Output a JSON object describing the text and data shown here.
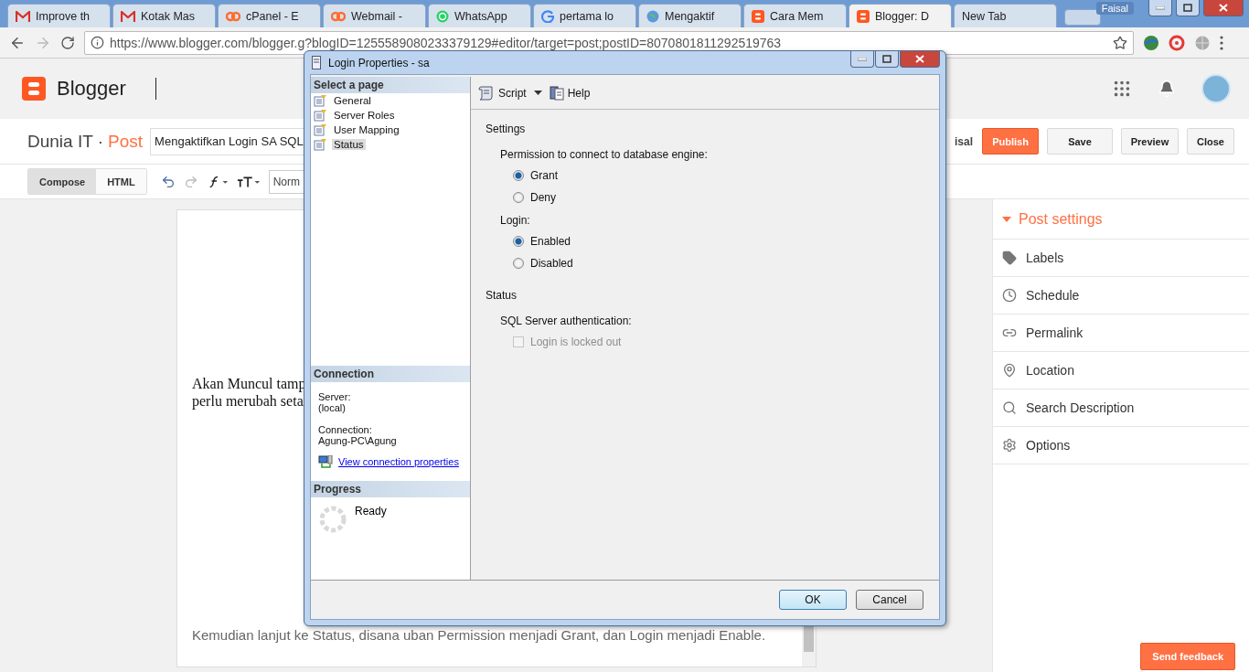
{
  "browser": {
    "tabs": [
      {
        "label": "Improve th",
        "kind": "gmail",
        "selected": false
      },
      {
        "label": "Kotak Mas",
        "kind": "gmail",
        "selected": false
      },
      {
        "label": "cPanel - E",
        "kind": "cpanel",
        "selected": false
      },
      {
        "label": "Webmail -",
        "kind": "cpanel",
        "selected": false
      },
      {
        "label": "WhatsApp",
        "kind": "whatsapp",
        "selected": false
      },
      {
        "label": "pertama lo",
        "kind": "google",
        "selected": false
      },
      {
        "label": "Mengaktif",
        "kind": "globe",
        "selected": false
      },
      {
        "label": "Cara Mem",
        "kind": "blogger",
        "selected": false
      },
      {
        "label": "Blogger: D",
        "kind": "blogger",
        "selected": true
      },
      {
        "label": "New Tab",
        "kind": "plain",
        "selected": false
      }
    ],
    "user": "Faisal",
    "url": "https://www.blogger.com/blogger.g?blogID=1255589080233379129#editor/target=post;postID=8070801811292519763"
  },
  "blogger": {
    "brand": "Blogger",
    "blog_name": "Dunia IT ·",
    "section": "Post",
    "post_title": "Mengaktifkan Login SA SQL",
    "author": "isal",
    "actions": [
      {
        "label": "Publish",
        "kind": "primary"
      },
      {
        "label": "Save",
        "kind": "default"
      },
      {
        "label": "Preview",
        "kind": "default"
      },
      {
        "label": "Close",
        "kind": "default"
      }
    ],
    "modes": [
      {
        "label": "Compose",
        "selected": true
      },
      {
        "label": "HTML",
        "selected": false
      }
    ],
    "format": "Norm",
    "editor_lines": [
      "Akan Muncul tamp",
      "perlu merubah seta"
    ],
    "editor_bottom": "Kemudian lanjut ke Status, disana uban Permission menjadi Grant, dan Login menjadi Enable.",
    "settings": {
      "title": "Post settings",
      "expanded": true,
      "items": [
        {
          "label": "Labels",
          "kind": "tag"
        },
        {
          "label": "Schedule",
          "kind": "clock"
        },
        {
          "label": "Permalink",
          "kind": "link"
        },
        {
          "label": "Location",
          "kind": "pin"
        },
        {
          "label": "Search Description",
          "kind": "search"
        },
        {
          "label": "Options",
          "kind": "gear"
        }
      ]
    },
    "feedback": "Send feedback"
  },
  "dialog": {
    "title": "Login Properties - sa",
    "select_heading": "Select a page",
    "pages": [
      {
        "label": "General",
        "selected": false
      },
      {
        "label": "Server Roles",
        "selected": false
      },
      {
        "label": "User Mapping",
        "selected": false
      },
      {
        "label": "Status",
        "selected": true
      }
    ],
    "connection_heading": "Connection",
    "server_label": "Server:",
    "server": "(local)",
    "connection_label": "Connection:",
    "connection": "Agung-PC\\Agung",
    "connection_link": "View connection properties",
    "progress_heading": "Progress",
    "progress": "Ready",
    "toolbar": [
      "Script",
      "Help"
    ],
    "settings_heading": "Settings",
    "permission_label": "Permission to connect to database engine:",
    "permission_options": [
      {
        "label": "Grant",
        "selected": true
      },
      {
        "label": "Deny",
        "selected": false
      }
    ],
    "login_label": "Login:",
    "login_options": [
      {
        "label": "Enabled",
        "selected": true
      },
      {
        "label": "Disabled",
        "selected": false
      }
    ],
    "status_heading": "Status",
    "auth_label": "SQL Server authentication:",
    "locked_out": {
      "label": "Login is locked out",
      "checked": false,
      "disabled": true
    },
    "buttons": [
      {
        "label": "OK",
        "default": true
      },
      {
        "label": "Cancel",
        "default": false
      }
    ]
  }
}
